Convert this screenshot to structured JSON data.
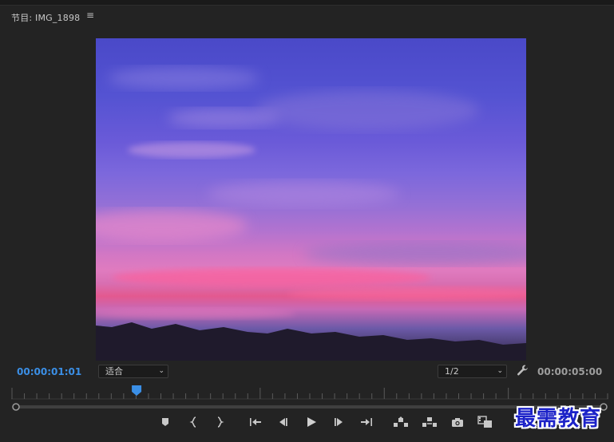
{
  "panel": {
    "title": "节目: IMG_1898",
    "menu_icon": "hamburger-menu-icon"
  },
  "controls": {
    "current_timecode": "00:00:01:01",
    "fit_select": {
      "value": "适合"
    },
    "resolution_select": {
      "value": "1/2"
    },
    "settings_icon": "wrench-icon",
    "duration_timecode": "00:00:05:00"
  },
  "playhead": {
    "position_fraction": 0.21
  },
  "transport": {
    "buttons": [
      {
        "name": "add-marker-button",
        "icon": "marker-icon"
      },
      {
        "name": "mark-in-button",
        "icon": "mark-in-icon"
      },
      {
        "name": "mark-out-button",
        "icon": "mark-out-icon"
      },
      {
        "name": "go-to-in-button",
        "icon": "go-to-in-icon"
      },
      {
        "name": "step-back-button",
        "icon": "step-back-icon"
      },
      {
        "name": "play-button",
        "icon": "play-icon"
      },
      {
        "name": "step-forward-button",
        "icon": "step-forward-icon"
      },
      {
        "name": "go-to-out-button",
        "icon": "go-to-out-icon"
      },
      {
        "name": "lift-button",
        "icon": "lift-icon"
      },
      {
        "name": "extract-button",
        "icon": "extract-icon"
      },
      {
        "name": "export-frame-button",
        "icon": "camera-icon"
      },
      {
        "name": "compare-view-button",
        "icon": "compare-icon"
      }
    ]
  },
  "accent_color": "#3b8fe6",
  "watermark": {
    "text": "最需教育"
  }
}
